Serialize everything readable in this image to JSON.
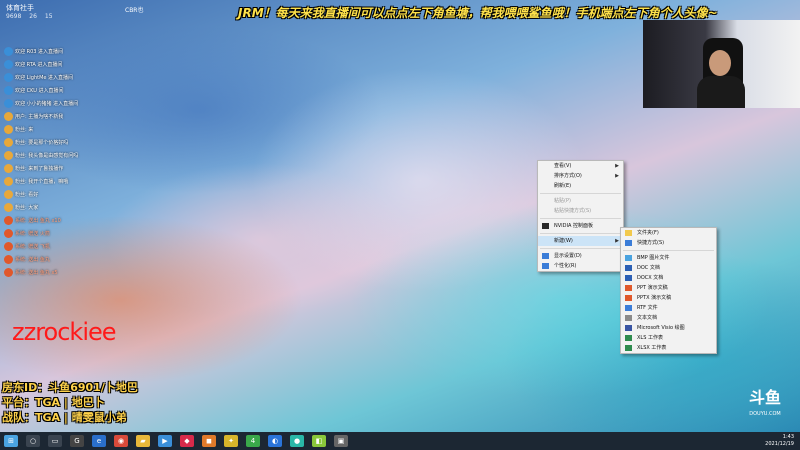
{
  "stream": {
    "title_banner": "JRM！每天来我直播间可以点点左下角鱼塘，帮我喂喂鲨鱼哦！手机端点左下角个人头像~",
    "room_header": {
      "name": "体育社手",
      "stats": [
        "9698",
        "26",
        "15"
      ],
      "extra": "CBR也"
    },
    "chat": [
      {
        "text": "欢迎 R03 进入直播间",
        "type": "welcome"
      },
      {
        "text": "欢迎 RTA 进入直播间",
        "type": "welcome"
      },
      {
        "text": "欢迎 LightMe 进入直播间",
        "type": "welcome"
      },
      {
        "text": "欢迎 CKU 进入直播间",
        "type": "welcome"
      },
      {
        "text": "欢迎 小小的猪猪 进入直播间",
        "type": "welcome"
      },
      {
        "text": "用户: 主播为啥不新我",
        "type": "msg"
      },
      {
        "text": "粉丝: 来",
        "type": "msg"
      },
      {
        "text": "粉丝: 要是那个价格好吗",
        "type": "msg"
      },
      {
        "text": "粉丝: 我头像是由感觉有问吗",
        "type": "msg"
      },
      {
        "text": "粉丝: 来到了鲁独播作",
        "type": "msg"
      },
      {
        "text": "粉丝: 我开个直播，嘛哦",
        "type": "msg"
      },
      {
        "text": "粉丝: 看好",
        "type": "msg"
      },
      {
        "text": "粉丝: 大家",
        "type": "msg"
      },
      {
        "text": "系统: 送出 鱼丸 x10",
        "type": "sys"
      },
      {
        "text": "系统: 赠送 火箭",
        "type": "sys"
      },
      {
        "text": "系统: 赠送 飞机",
        "type": "sys"
      },
      {
        "text": "系统: 送出 鱼丸",
        "type": "sys"
      },
      {
        "text": "系统: 送出 鱼丸 x5",
        "type": "sys"
      }
    ],
    "overlay_name": "zzrockiee",
    "info_lines": [
      "房东ID：斗鱼6901/卜地巴",
      "平台：TGA | 地巴卜",
      "战队：TGA | 晴雯鼠小弟"
    ],
    "logo": {
      "text": "斗鱼",
      "sub": "DOUYU.COM"
    }
  },
  "context_menu": {
    "items": [
      {
        "label": "查看(V)",
        "submenu": true,
        "disabled": false
      },
      {
        "label": "排序方式(O)",
        "submenu": true,
        "disabled": false
      },
      {
        "label": "刷新(E)",
        "submenu": false,
        "disabled": false
      },
      {
        "sep": true
      },
      {
        "label": "粘贴(P)",
        "submenu": false,
        "disabled": true
      },
      {
        "label": "粘贴快捷方式(S)",
        "submenu": false,
        "disabled": true
      },
      {
        "sep": true
      },
      {
        "label": "NVIDIA 控制面板",
        "submenu": false,
        "disabled": false,
        "icon": "nvidia-icon"
      },
      {
        "sep": true
      },
      {
        "label": "新建(W)",
        "submenu": true,
        "disabled": false,
        "highlight": true
      },
      {
        "sep": true
      },
      {
        "label": "显示设置(D)",
        "submenu": false,
        "disabled": false,
        "icon": "display-icon"
      },
      {
        "label": "个性化(R)",
        "submenu": false,
        "disabled": false,
        "icon": "personalize-icon"
      }
    ]
  },
  "new_submenu": {
    "items": [
      {
        "label": "文件夹(F)",
        "icon": "folder-icon",
        "color": "#f2c94c"
      },
      {
        "label": "快捷方式(S)",
        "icon": "shortcut-icon",
        "color": "#3b7dd8"
      },
      {
        "sep": true
      },
      {
        "label": "BMP 图片文件",
        "icon": "bmp-file-icon",
        "color": "#4aa3e0"
      },
      {
        "label": "DOC 文档",
        "icon": "doc-file-icon",
        "color": "#2b5fb4"
      },
      {
        "label": "DOCX 文档",
        "icon": "docx-file-icon",
        "color": "#2b5fb4"
      },
      {
        "label": "PPT 演示文稿",
        "icon": "ppt-file-icon",
        "color": "#e0582b"
      },
      {
        "label": "PPTX 演示文稿",
        "icon": "pptx-file-icon",
        "color": "#e0582b"
      },
      {
        "label": "RTF 文件",
        "icon": "rtf-file-icon",
        "color": "#3b7dd8"
      },
      {
        "label": "文本文档",
        "icon": "txt-file-icon",
        "color": "#8a8a8a"
      },
      {
        "label": "Microsoft Visio 绘图",
        "icon": "visio-file-icon",
        "color": "#3955a3"
      },
      {
        "label": "XLS 工作表",
        "icon": "xls-file-icon",
        "color": "#2e8b4e"
      },
      {
        "label": "XLSX 工作表",
        "icon": "xlsx-file-icon",
        "color": "#2e8b4e"
      }
    ]
  },
  "taskbar": {
    "icons": [
      {
        "name": "start-icon",
        "color": "#4aa3e0",
        "glyph": "⊞"
      },
      {
        "name": "search-icon",
        "color": "#3a4450",
        "glyph": "○"
      },
      {
        "name": "task-view-icon",
        "color": "#3a4450",
        "glyph": "▭"
      },
      {
        "name": "app-g-icon",
        "color": "#444",
        "glyph": "G"
      },
      {
        "name": "edge-icon",
        "color": "#2a6fcb",
        "glyph": "e"
      },
      {
        "name": "chrome-icon",
        "color": "#d94a3a",
        "glyph": "◉"
      },
      {
        "name": "file-explorer-icon",
        "color": "#e8b83a",
        "glyph": "▰"
      },
      {
        "name": "media-icon",
        "color": "#3a8fd8",
        "glyph": "▶"
      },
      {
        "name": "app-red-icon",
        "color": "#d82a4a",
        "glyph": "◆"
      },
      {
        "name": "app-orange-icon",
        "color": "#e07a2a",
        "glyph": "◼"
      },
      {
        "name": "app-yellow-icon",
        "color": "#d8b52a",
        "glyph": "✦"
      },
      {
        "name": "app-green-icon",
        "color": "#3aa84a",
        "glyph": "4"
      },
      {
        "name": "app-blue-icon",
        "color": "#2a74d8",
        "glyph": "◐"
      },
      {
        "name": "app-teal-icon",
        "color": "#2ab8a8",
        "glyph": "●"
      },
      {
        "name": "app-lime-icon",
        "color": "#8ac83a",
        "glyph": "◧"
      },
      {
        "name": "app-gray-icon",
        "color": "#666",
        "glyph": "▣"
      }
    ],
    "tray_time": "1:43",
    "tray_date": "2021/12/19"
  }
}
